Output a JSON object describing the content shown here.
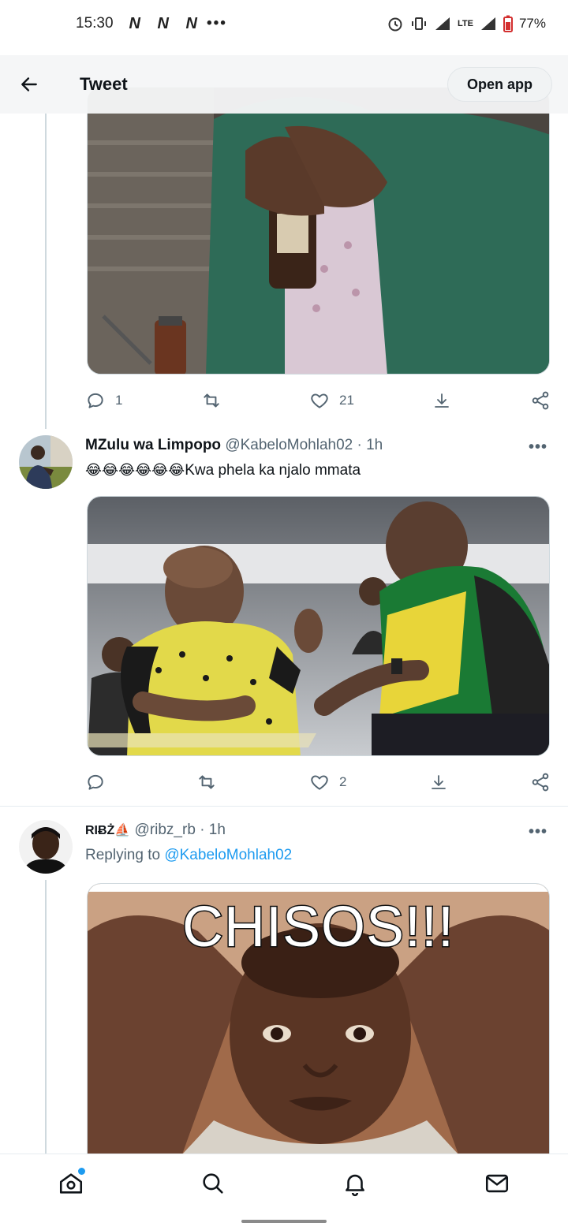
{
  "status_bar": {
    "time": "15:30",
    "notif_glyphs": "N N N",
    "more_dots": "•••",
    "network": "LTE",
    "battery": "77%"
  },
  "header": {
    "title": "Tweet",
    "open_app_label": "Open app"
  },
  "tweets": [
    {
      "stats": {
        "reply_count": "1",
        "like_count": "21"
      }
    },
    {
      "name": "MZulu wa Limpopo",
      "handle": "@KabeloMohlah02",
      "time": "· 1h",
      "emojis": "😂😂😂😂😂😂",
      "text": "Kwa phela ka njalo mmata",
      "stats": {
        "reply_count": "",
        "like_count": "2"
      }
    },
    {
      "name": "RIɃŻ⛵",
      "handle": "@ribz_rb",
      "time": "· 1h",
      "reply_prefix": "Replying to",
      "reply_handle": "@KabeloMohlah02",
      "meme_text": "CHISOS!!!"
    }
  ],
  "colors": {
    "accent": "#1d9bf0",
    "text": "#0f1419",
    "secondary": "#536471"
  }
}
